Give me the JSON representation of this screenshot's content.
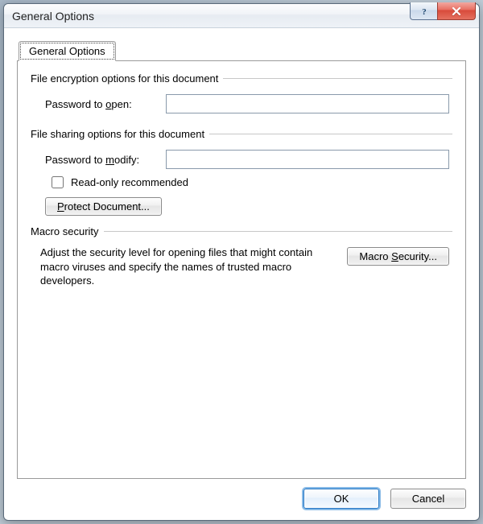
{
  "window": {
    "title": "General Options",
    "help_tooltip": "Help",
    "close_tooltip": "Close"
  },
  "tab": {
    "label": "General Options"
  },
  "encryption": {
    "legend": "File encryption options for this document",
    "password_open_label_pre": "Password to ",
    "password_open_label_ul": "o",
    "password_open_label_post": "pen:",
    "password_open_value": ""
  },
  "sharing": {
    "legend": "File sharing options for this document",
    "password_modify_label_pre": "Password to ",
    "password_modify_label_ul": "m",
    "password_modify_label_post": "odify:",
    "password_modify_value": "",
    "read_only_checked": false,
    "read_only_label": "Read-only recommended",
    "protect_button_label_ul": "P",
    "protect_button_label_post": "rotect Document..."
  },
  "macro": {
    "legend": "Macro security",
    "description": "Adjust the security level for opening files that might contain macro viruses and specify the names of trusted macro developers.",
    "button_label_pre": "Macro ",
    "button_label_ul": "S",
    "button_label_post": "ecurity..."
  },
  "footer": {
    "ok": "OK",
    "cancel": "Cancel"
  }
}
